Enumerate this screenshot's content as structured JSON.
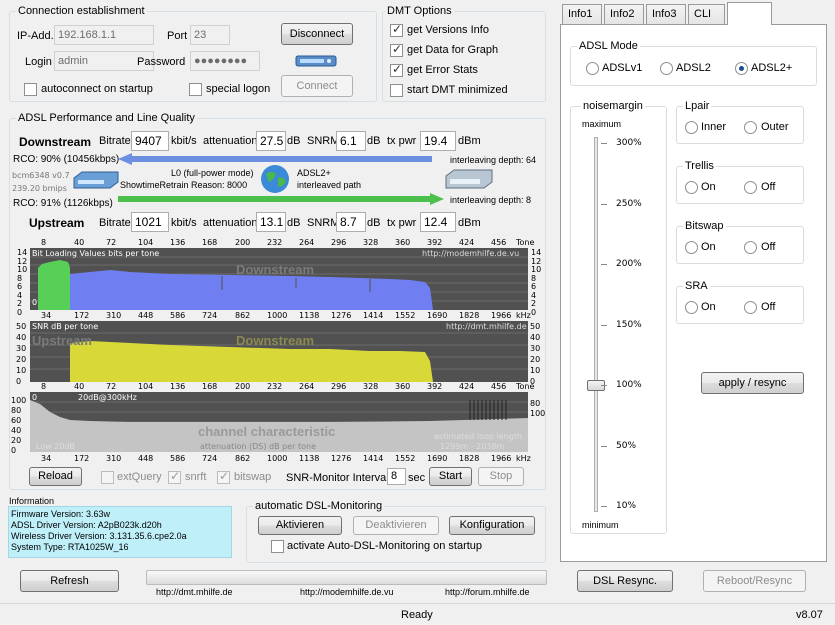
{
  "connection": {
    "title": "Connection establishment",
    "ip_label": "IP-Add.",
    "ip_value": "192.168.1.1",
    "port_label": "Port",
    "port_value": "23",
    "login_label": "Login",
    "login_value": "admin",
    "password_label": "Password",
    "password_value": "●●●●●●●●",
    "disconnect_label": "Disconnect",
    "connect_label": "Connect",
    "autoconnect_label": "autoconnect on startup",
    "special_logon_label": "special logon"
  },
  "dmt_options": {
    "title": "DMT Options",
    "items": [
      {
        "label": "get Versions Info",
        "checked": true
      },
      {
        "label": "get Data for Graph",
        "checked": true
      },
      {
        "label": "get Error Stats",
        "checked": true
      },
      {
        "label": "start DMT minimized",
        "checked": false
      }
    ]
  },
  "performance": {
    "title": "ADSL Performance and Line Quality",
    "downstream_label": "Downstream",
    "upstream_label": "Upstream",
    "bitrate_label": "Bitrate",
    "kbits": "kbit/s",
    "attenuation_label": "attenuation",
    "db": "dB",
    "snrm_label": "SNRM",
    "txpwr_label": "tx pwr",
    "dbm": "dBm",
    "down": {
      "bitrate": "9407",
      "attenuation": "27.5",
      "snrm": "6.1",
      "txpwr": "19.4"
    },
    "up": {
      "bitrate": "1021",
      "attenuation": "13.1",
      "snrm": "8.7",
      "txpwr": "12.4"
    },
    "rco_down": "RCO: 90% (10456kbps)",
    "rco_up": "RCO: 91% (1126kbps)",
    "modem_fw": "bcm6348 v0.7",
    "modem_rate": "239.20 bmips",
    "state": "L0 (full-power mode)",
    "retrain": "ShowtimeRetrain Reason: 8000",
    "mode": "ADSL2+",
    "path": "interleaved path",
    "interleave_down": "interleaving depth: 64",
    "interleave_up": "interleaving depth: 8"
  },
  "graphs": {
    "tone_ticks": [
      "8",
      "40",
      "72",
      "104",
      "136",
      "168",
      "200",
      "232",
      "264",
      "296",
      "328",
      "360",
      "392",
      "424",
      "456",
      "Tone"
    ],
    "khz_ticks": [
      "34",
      "172",
      "310",
      "448",
      "586",
      "724",
      "862",
      "1000",
      "1138",
      "1276",
      "1414",
      "1552",
      "1690",
      "1828",
      "1966",
      "kHz"
    ],
    "bitload_title": "Bit Loading Values   bits per tone",
    "bitload_url": "http://modemhilfe.de.vu",
    "bitload_yticks": [
      "14",
      "12",
      "10",
      "8",
      "6",
      "4",
      "2",
      "0"
    ],
    "bitload_watermark": "Downstream",
    "bitload_up_watermark": "Upstream",
    "snr_title": "SNR  dB per tone",
    "snr_url": "http://dmt.mhilfe.de",
    "snr_yticks": [
      "50",
      "40",
      "30",
      "20",
      "10",
      "0"
    ],
    "snr_watermark_down": "Downstream",
    "snr_watermark_up": "Upstream",
    "chan_yticks": [
      "100",
      "80",
      "60",
      "40",
      "20",
      "0"
    ],
    "chan_right_ticks": [
      "80",
      "100"
    ],
    "chan_label": "20dB@300kHz",
    "chan_watermark": "channel characteristic",
    "chan_sub": "attenuation (DS)   dB per tone",
    "chan_low": "Low 20dB",
    "loop_length": "estimated loop length",
    "loop_value": "1299m  -  2038m"
  },
  "controls": {
    "reload": "Reload",
    "extquery": "extQuery",
    "snrft": "snrft",
    "bitswap": "bitswap",
    "snr_interval_label": "SNR-Monitor Interval:",
    "snr_interval": "8",
    "sec": "sec",
    "start": "Start",
    "stop": "Stop"
  },
  "information": {
    "title": "Information",
    "lines": [
      "Firmware Version: 3.63w",
      "ADSL Driver Version: A2pB023k.d20h",
      "Wireless Driver Version: 3.131.35.6.cpe2.0a",
      "System Type: RTA1025W_16"
    ]
  },
  "monitoring": {
    "title": "automatic DSL-Monitoring",
    "activate": "Aktivieren",
    "deactivate": "Deaktivieren",
    "config": "Konfiguration",
    "startup_label": "activate Auto-DSL-Monitoring on startup"
  },
  "bottom": {
    "refresh": "Refresh",
    "dsl_resync": "DSL Resync.",
    "reboot": "Reboot/Resync",
    "link1": "http://dmt.mhilfe.de",
    "link2": "http://modemhilfe.de.vu",
    "link3": "http://forum.mhilfe.de",
    "status": "Ready",
    "version": "v8.07"
  },
  "tabs": [
    "Info1",
    "Info2",
    "Info3",
    "CLI",
    ""
  ],
  "right": {
    "adsl_mode_title": "ADSL Mode",
    "modes": [
      {
        "label": "ADSLv1",
        "selected": false
      },
      {
        "label": "ADSL2",
        "selected": false
      },
      {
        "label": "ADSL2+",
        "selected": true
      }
    ],
    "noisemargin_title": "noisemargin",
    "max_label": "maximum",
    "min_label": "minimum",
    "slider_ticks": [
      "300%",
      "250%",
      "200%",
      "150%",
      "100%",
      "50%",
      "10%"
    ],
    "slider_value_percent": 100,
    "lpair": {
      "title": "Lpair",
      "a": "Inner",
      "b": "Outer"
    },
    "trellis": {
      "title": "Trellis",
      "a": "On",
      "b": "Off"
    },
    "bitswap": {
      "title": "Bitswap",
      "a": "On",
      "b": "Off"
    },
    "sra": {
      "title": "SRA",
      "a": "On",
      "b": "Off"
    },
    "apply": "apply / resync"
  }
}
